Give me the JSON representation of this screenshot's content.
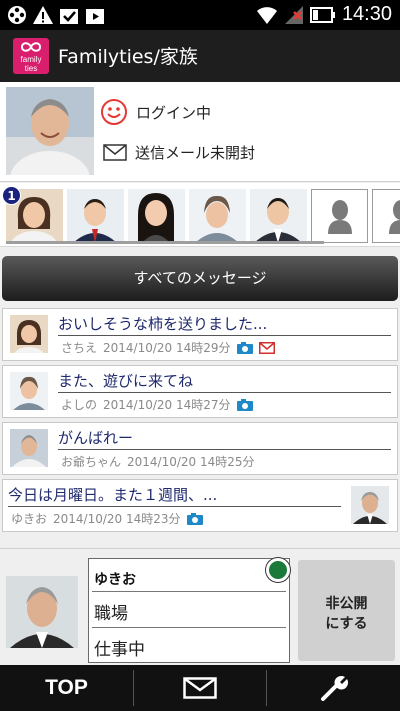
{
  "statusbar": {
    "time": "14:30"
  },
  "app": {
    "logo_line1": "family",
    "logo_line2": "ties",
    "title": "Familyties/家族"
  },
  "profile": {
    "login_status": "ログイン中",
    "mail_status": "送信メール未開封"
  },
  "family": {
    "badge_count": "1"
  },
  "all_messages_label": "すべてのメッセージ",
  "messages": [
    {
      "title": "おいしそうな柿を送りました...",
      "sender": "さちえ",
      "datetime": "2014/10/20 14時29分"
    },
    {
      "title": "また、遊びに来てね",
      "sender": "よしの",
      "datetime": "2014/10/20 14時27分"
    },
    {
      "title": "がんばれー",
      "sender": "お爺ちゃん",
      "datetime": "2014/10/20 14時25分"
    },
    {
      "title": "今日は月曜日。また１週間、...",
      "sender": "ゆきお",
      "datetime": "2014/10/20 14時23分"
    }
  ],
  "bottom_profile": {
    "name": "ゆきお",
    "place": "職場",
    "status": "仕事中",
    "private_line1": "非公開",
    "private_line2": "にする"
  },
  "nav": {
    "top_label": "TOP"
  },
  "colors": {
    "accent_pink": "#d81e6c",
    "title_navy": "#1f2a6e",
    "badge_navy": "#1a237e",
    "online_green": "#1b7a3a",
    "camera_blue": "#1e88c8",
    "mail_red": "#d32f2f"
  }
}
